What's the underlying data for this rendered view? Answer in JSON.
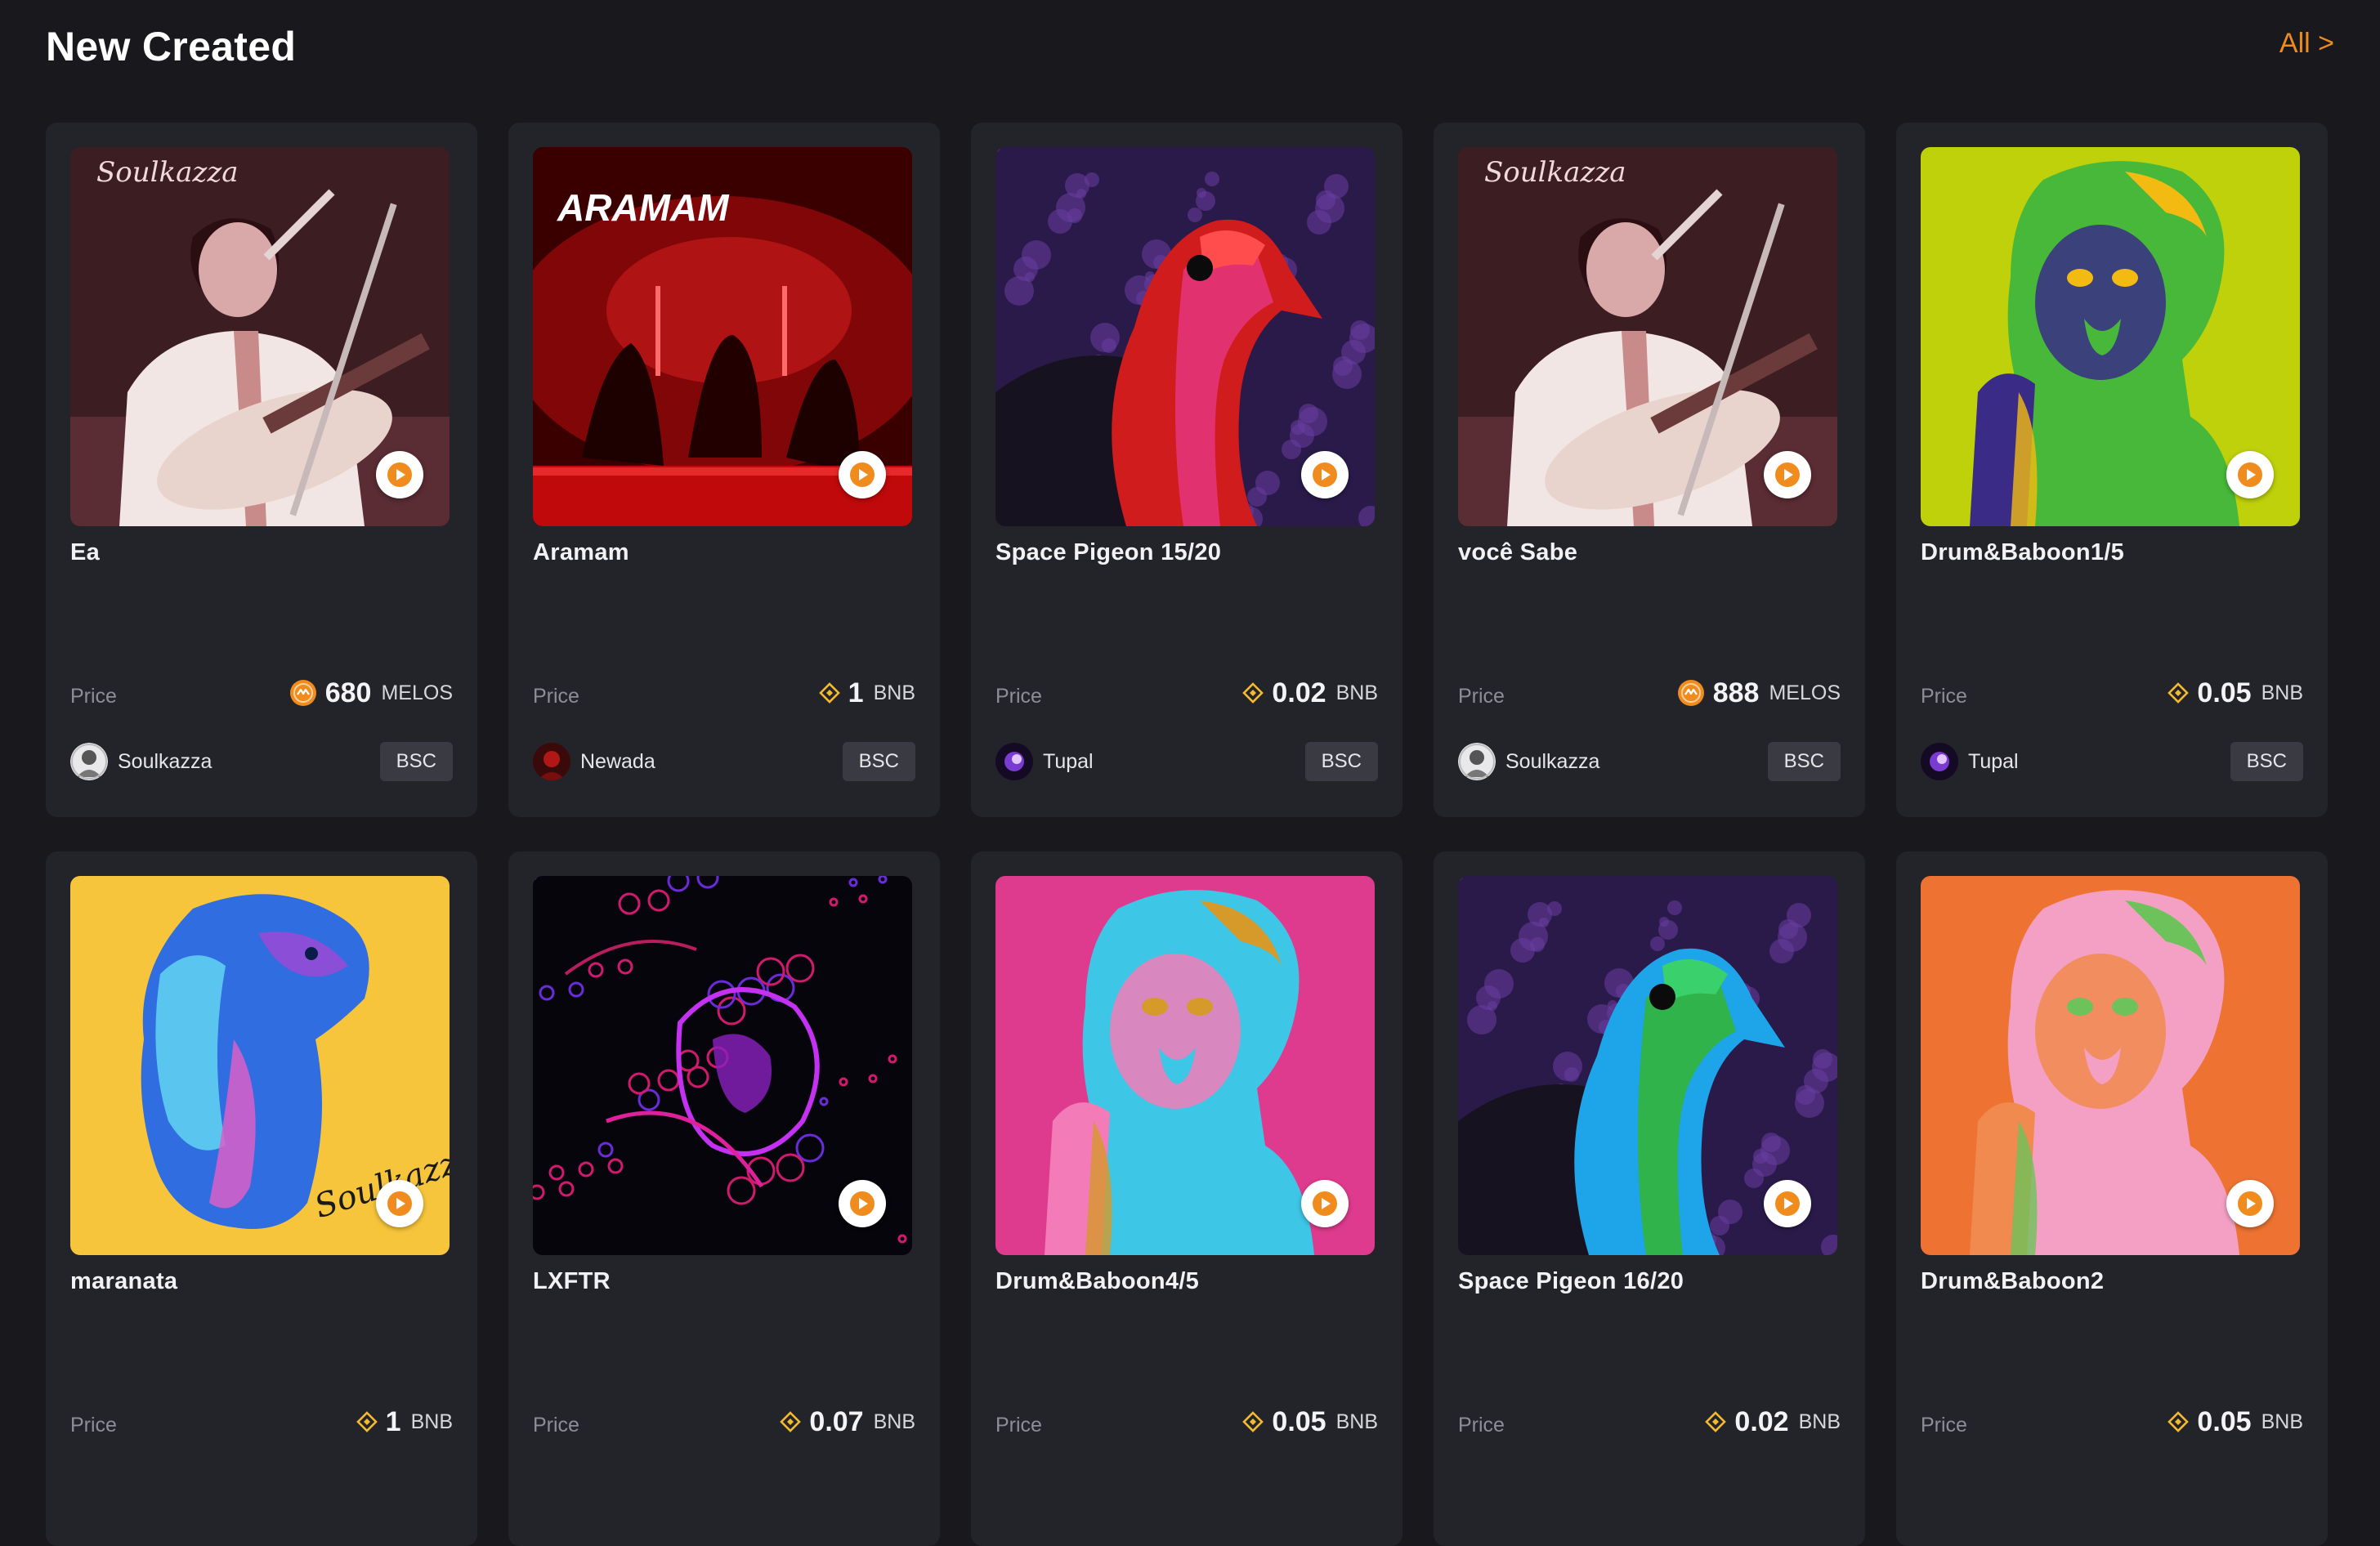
{
  "header": {
    "title": "New Created",
    "all_link": "All >"
  },
  "price_label": "Price",
  "cards": [
    {
      "title": "Ea",
      "price": "680",
      "unit": "MELOS",
      "coin": "melos-coin-icon",
      "creator": "Soulkazza",
      "chain": "BSC",
      "art": "singer"
    },
    {
      "title": "Aramam",
      "price": "1",
      "unit": "BNB",
      "coin": "bnb-coin-icon",
      "creator": "Newada",
      "chain": "BSC",
      "art": "aramam",
      "art_text": "ARAMAM"
    },
    {
      "title": "Space Pigeon 15/20",
      "price": "0.02",
      "unit": "BNB",
      "coin": "bnb-coin-icon",
      "creator": "Tupal",
      "chain": "BSC",
      "art": "pigeon-red"
    },
    {
      "title": "você Sabe",
      "price": "888",
      "unit": "MELOS",
      "coin": "melos-coin-icon",
      "creator": "Soulkazza",
      "chain": "BSC",
      "art": "singer"
    },
    {
      "title": "Drum&Baboon1/5",
      "price": "0.05",
      "unit": "BNB",
      "coin": "bnb-coin-icon",
      "creator": "Tupal",
      "chain": "BSC",
      "art": "baboon-lime"
    },
    {
      "title": "maranata",
      "price": "1",
      "unit": "BNB",
      "coin": "bnb-coin-icon",
      "art": "dog"
    },
    {
      "title": "LXFTR",
      "price": "0.07",
      "unit": "BNB",
      "coin": "bnb-coin-icon",
      "art": "lxftr"
    },
    {
      "title": "Drum&Baboon4/5",
      "price": "0.05",
      "unit": "BNB",
      "coin": "bnb-coin-icon",
      "art": "baboon-pink"
    },
    {
      "title": "Space Pigeon 16/20",
      "price": "0.02",
      "unit": "BNB",
      "coin": "bnb-coin-icon",
      "art": "pigeon-blue"
    },
    {
      "title": "Drum&Baboon2",
      "price": "0.05",
      "unit": "BNB",
      "coin": "bnb-coin-icon",
      "art": "baboon-orange"
    }
  ],
  "colors": {
    "accent": "#f08c1d",
    "bnb": "#f3ba2f",
    "card_bg": "#23232a",
    "page_bg": "#18181d"
  }
}
